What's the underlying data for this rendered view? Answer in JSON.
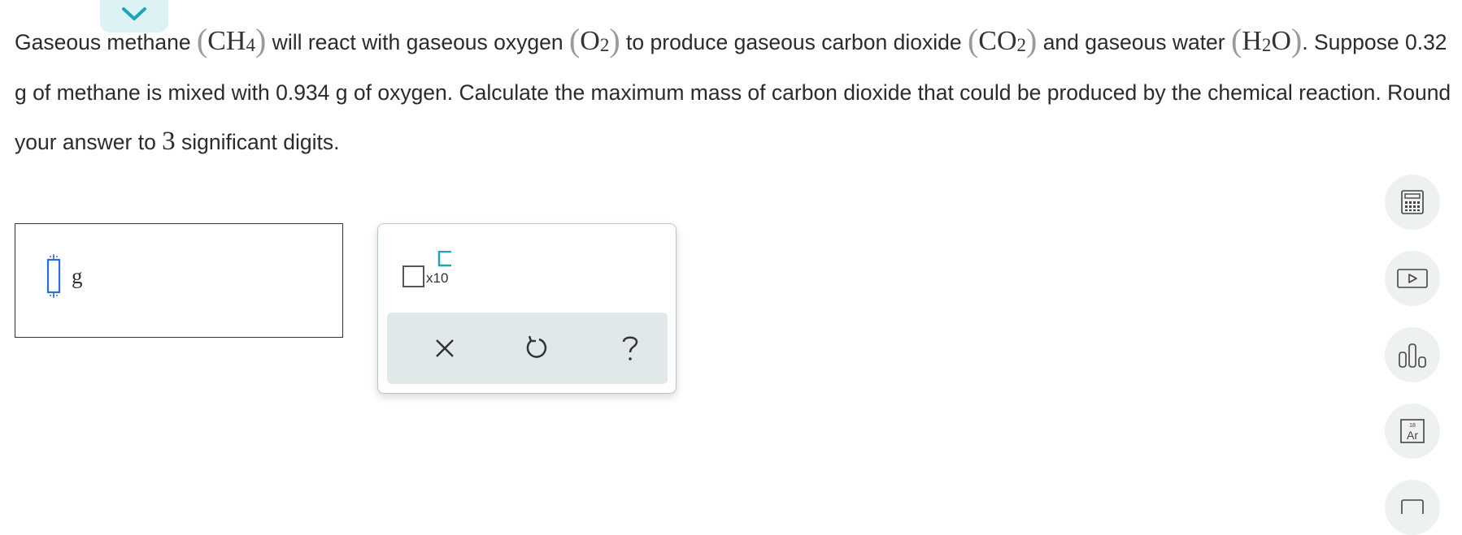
{
  "question": {
    "p1": "Gaseous methane ",
    "methane_formula": "CH",
    "methane_sub": "4",
    "p2": " will react with gaseous oxygen ",
    "oxygen_formula": "O",
    "oxygen_sub": "2",
    "p3": " to produce gaseous carbon dioxide ",
    "co2_formula": "CO",
    "co2_sub": "2",
    "p4": " and gaseous water ",
    "water_h": "H",
    "water_sub": "2",
    "water_o": "O",
    "p5": ". Suppose 0.32 g of methane is mixed with 0.934 g of oxygen. Calculate the maximum mass of carbon dioxide that could be produced by the chemical reaction. Round your answer to ",
    "sig_figs": "3",
    "p6": " significant digits."
  },
  "answer": {
    "value": "",
    "unit": "g"
  },
  "palette": {
    "sci_notation_label": "x10"
  },
  "icons": {
    "collapse": "chevron-down-icon",
    "clear": "close-icon",
    "undo": "undo-icon",
    "help": "help-icon",
    "calculator": "calculator-icon",
    "video": "play-icon",
    "data": "bar-chart-icon",
    "periodic_table": "periodic-table-icon"
  },
  "periodic_table_icon": {
    "number": "18",
    "symbol": "Ar"
  },
  "colors": {
    "accent": "#1aa6b7",
    "tab_bg": "#dcf2f5",
    "palette_bar": "#e1e8ea",
    "cursor": "#2a6fd6"
  }
}
